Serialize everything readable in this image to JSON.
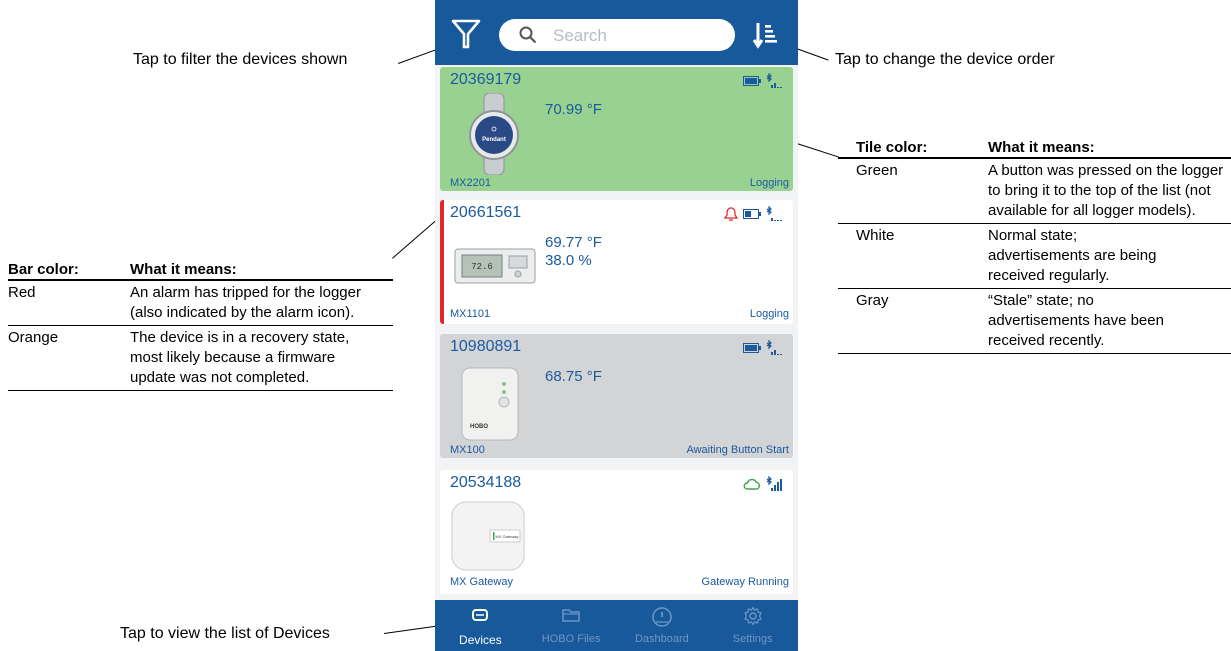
{
  "callouts": {
    "filter": "Tap to filter the devices shown",
    "order": "Tap to change the device order",
    "devices": "Tap to view the list of Devices"
  },
  "search": {
    "placeholder": "Search"
  },
  "tiles": [
    {
      "serial": "20369179",
      "readings": [
        "70.99 °F"
      ],
      "model": "MX2201",
      "status": "Logging",
      "color": "#98d190",
      "bar": ""
    },
    {
      "serial": "20661561",
      "readings": [
        "69.77 °F",
        "38.0 %"
      ],
      "model": "MX1101",
      "status": "Logging",
      "color": "#ffffff",
      "bar": "#e0282e"
    },
    {
      "serial": "10980891",
      "readings": [
        "68.75 °F"
      ],
      "model": "MX100",
      "status": "Awaiting Button Start",
      "color": "#d3d4d6",
      "bar": ""
    },
    {
      "serial": "20534188",
      "readings": [],
      "model": "MX Gateway",
      "status": "Gateway Running",
      "color": "#ffffff",
      "bar": ""
    }
  ],
  "nav": [
    {
      "label": "Devices",
      "icon": "devices-icon",
      "active": true
    },
    {
      "label": "HOBO Files",
      "icon": "folder-icon",
      "active": false
    },
    {
      "label": "Dashboard",
      "icon": "dashboard-icon",
      "active": false
    },
    {
      "label": "Settings",
      "icon": "gear-icon",
      "active": false
    }
  ],
  "bar_table": {
    "headers": [
      "Bar color:",
      "What it means:"
    ],
    "rows": [
      [
        "Red",
        "An alarm has tripped for the logger (also indicated by the alarm icon)."
      ],
      [
        "Orange",
        "The device is in a recovery state, most likely because a firmware update was not completed."
      ]
    ]
  },
  "tile_table": {
    "headers": [
      "Tile color:",
      "What it means:"
    ],
    "rows": [
      [
        "Green",
        "A button was pressed on the logger to bring it to the top of the list (not available for all logger models)."
      ],
      [
        "White",
        "Normal state; advertisements are being received regularly."
      ],
      [
        "Gray",
        "“Stale” state; no advertisements have been received recently."
      ]
    ]
  },
  "colors": {
    "app_bar": "#17599a",
    "accent_text": "#1c5aa0",
    "alarm": "#e0282e",
    "cloud": "#3aa845"
  }
}
